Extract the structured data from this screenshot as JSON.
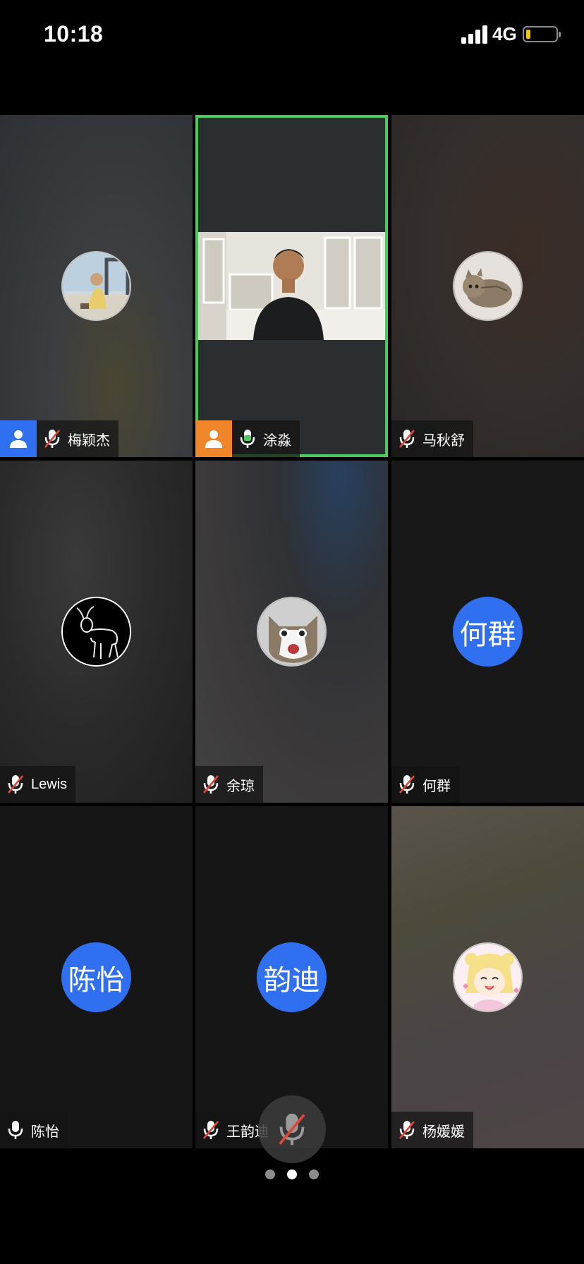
{
  "status_bar": {
    "time": "10:18",
    "network": "4G"
  },
  "participants": [
    {
      "name": "梅颖杰",
      "mic": "muted",
      "role_badge": "host",
      "avatar": "photo-person-window"
    },
    {
      "name": "涂淼",
      "mic": "speaking",
      "role_badge": "cohost",
      "video": "on",
      "active_speaker": true
    },
    {
      "name": "马秋舒",
      "mic": "muted",
      "avatar": "photo-kitten"
    },
    {
      "name": "Lewis",
      "mic": "muted",
      "avatar": "photo-goat-sketch"
    },
    {
      "name": "余琼",
      "mic": "muted",
      "avatar": "photo-cat-face"
    },
    {
      "name": "何群",
      "mic": "muted",
      "avatar_text": "何群"
    },
    {
      "name": "陈怡",
      "mic": "on",
      "avatar_text": "陈怡"
    },
    {
      "name": "王韵迪",
      "mic": "muted",
      "avatar_text": "韵迪"
    },
    {
      "name": "杨媛媛",
      "mic": "muted",
      "avatar": "photo-anime-girl"
    }
  ],
  "floating_mic": {
    "state": "muted"
  },
  "pagination": {
    "pages": 3,
    "current": 2
  },
  "colors": {
    "accent_blue": "#2f6ff0",
    "active_green": "#4cc95c",
    "cohost_orange": "#f0852a",
    "mute_red": "#e0453a"
  }
}
